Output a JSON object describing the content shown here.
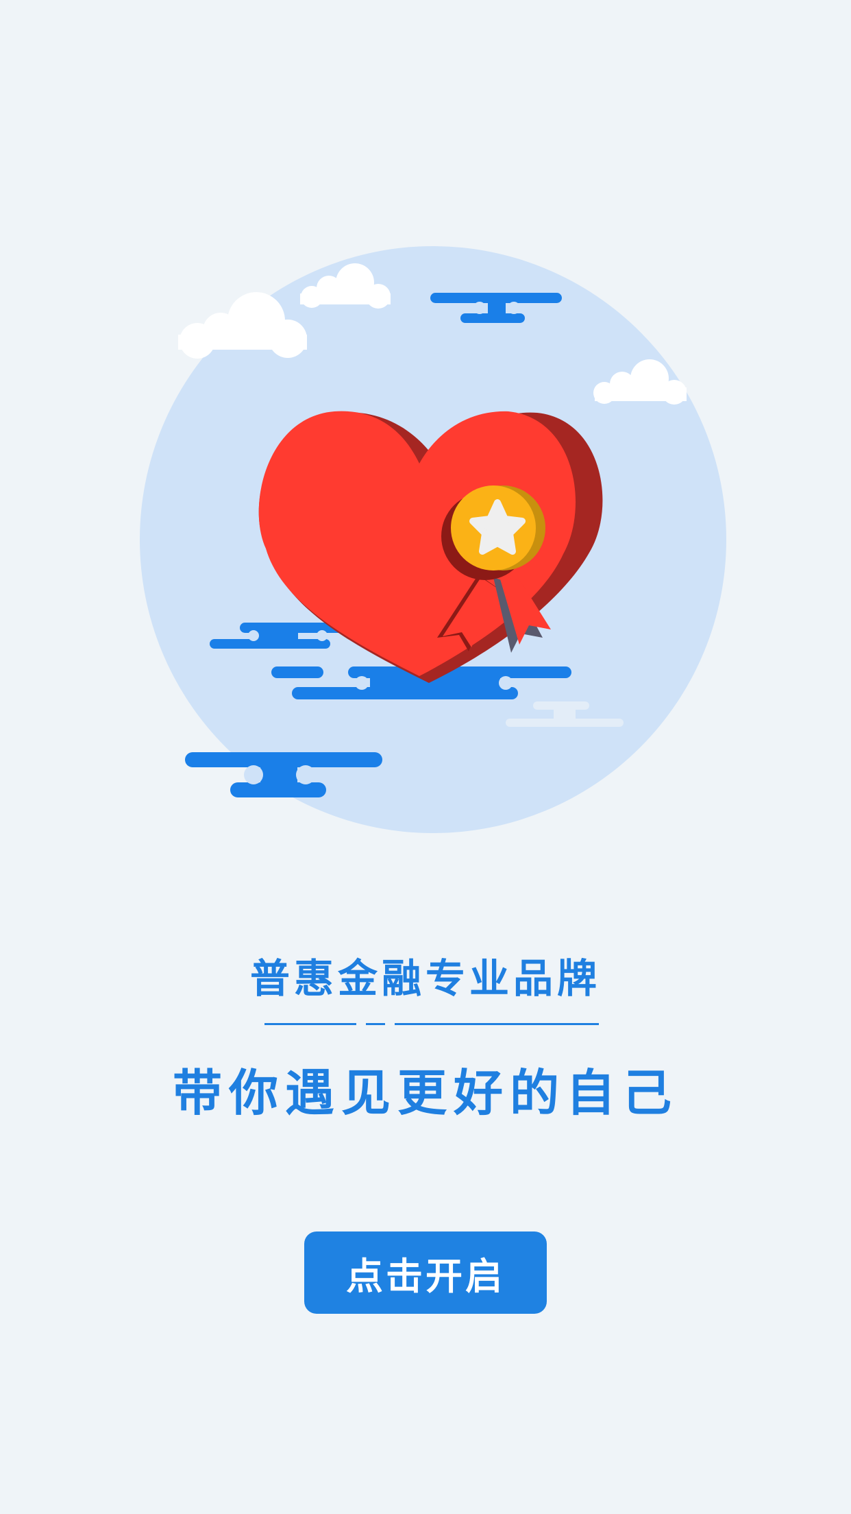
{
  "app": {
    "background_color": "#eff4f8",
    "accent_color": "#1f7fe0"
  },
  "hero": {
    "illustration": "heart-with-medal-icon",
    "circle_color": "#cfe2f8",
    "heart_color": "#ff3b30",
    "medal_color": "#fbb216",
    "cloud_color": "#ffffff",
    "streak_color": "#1a7fe8"
  },
  "tagline": {
    "line1": "普惠金融专业品牌",
    "line2": "带你遇见更好的自己"
  },
  "start_button": {
    "label": "点击开启",
    "color": "#1f82e2"
  }
}
